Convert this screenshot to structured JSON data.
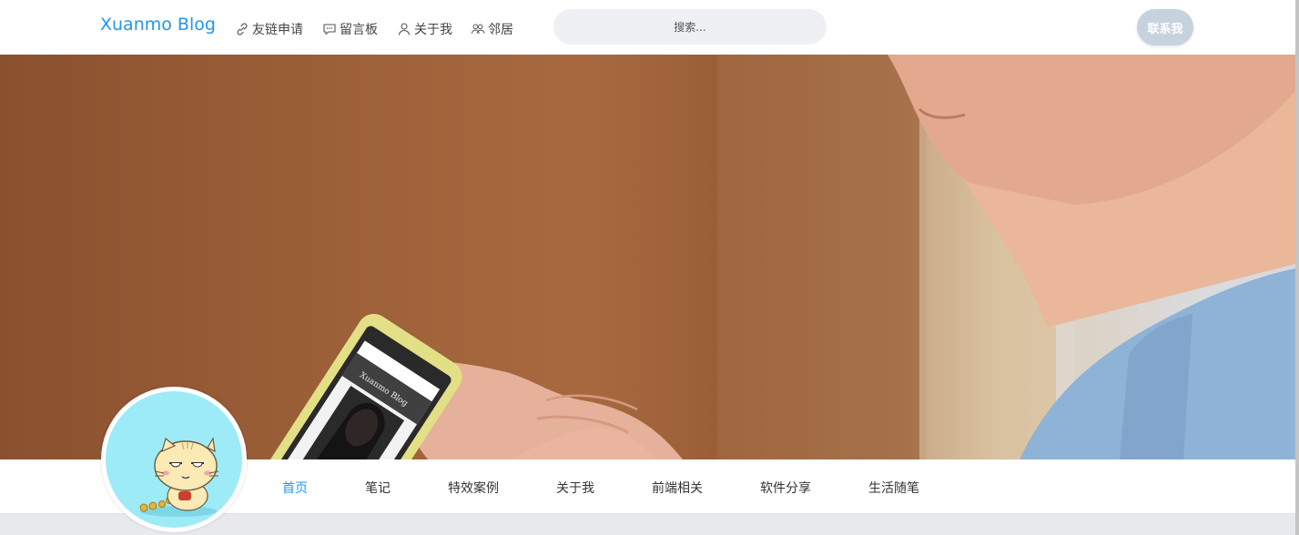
{
  "header": {
    "brand": "Xuanmo Blog",
    "nav": [
      {
        "label": "友链申请",
        "icon": "link-icon"
      },
      {
        "label": "留言板",
        "icon": "message-icon"
      },
      {
        "label": "关于我",
        "icon": "user-icon"
      },
      {
        "label": "邻居",
        "icon": "users-icon"
      }
    ],
    "search_placeholder": "搜索...",
    "contact_label": "联系我"
  },
  "hero": {
    "image": "banner-photo",
    "phone_screen_title": "Xuanmo Blog"
  },
  "categories": [
    {
      "label": "首页",
      "active": true
    },
    {
      "label": "笔记",
      "active": false
    },
    {
      "label": "特效案例",
      "active": false
    },
    {
      "label": "关于我",
      "active": false
    },
    {
      "label": "前端相关",
      "active": false
    },
    {
      "label": "软件分享",
      "active": false
    },
    {
      "label": "生活随笔",
      "active": false
    }
  ],
  "colors": {
    "brand": "#2196f3",
    "contact_button": "#c6d3df",
    "avatar_bg": "#9debf7",
    "page_bg": "#e8e9ed"
  }
}
